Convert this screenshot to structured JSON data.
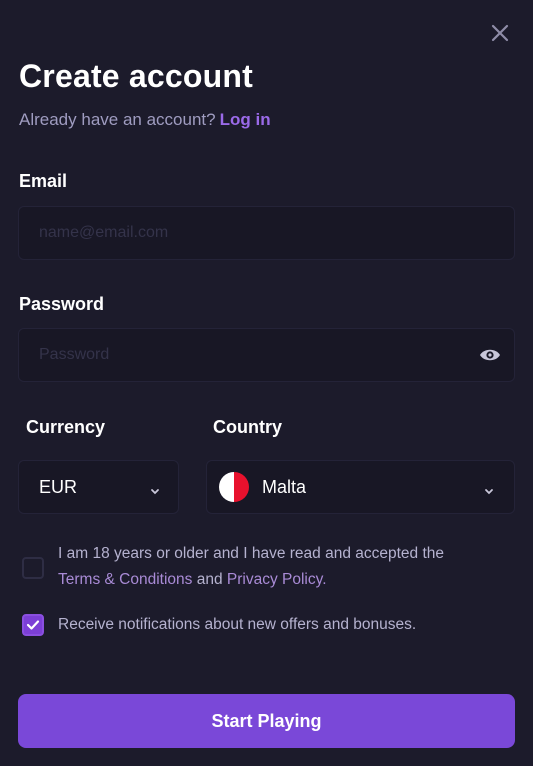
{
  "dialog": {
    "title": "Create account",
    "login_prompt": "Already have an account?",
    "login_link": "Log in"
  },
  "email": {
    "label": "Email",
    "placeholder": "name@email.com",
    "value": ""
  },
  "password": {
    "label": "Password",
    "placeholder": "Password",
    "value": ""
  },
  "currency": {
    "label": "Currency",
    "selected": "EUR"
  },
  "country": {
    "label": "Country",
    "selected": "Malta",
    "flag_colors": [
      "#ffffff",
      "#e8112d"
    ]
  },
  "terms": {
    "checked": false,
    "text_prefix": "I am 18 years or older and I have read and accepted the",
    "terms_link": "Terms & Conditions",
    "and_text": "and",
    "privacy_link": "Privacy Policy."
  },
  "notifications": {
    "checked": true,
    "text": "Receive notifications about new offers and bonuses."
  },
  "submit_label": "Start Playing",
  "colors": {
    "background": "#1c1b2b",
    "accent": "#7a48d8",
    "link": "#9a6ae8"
  }
}
